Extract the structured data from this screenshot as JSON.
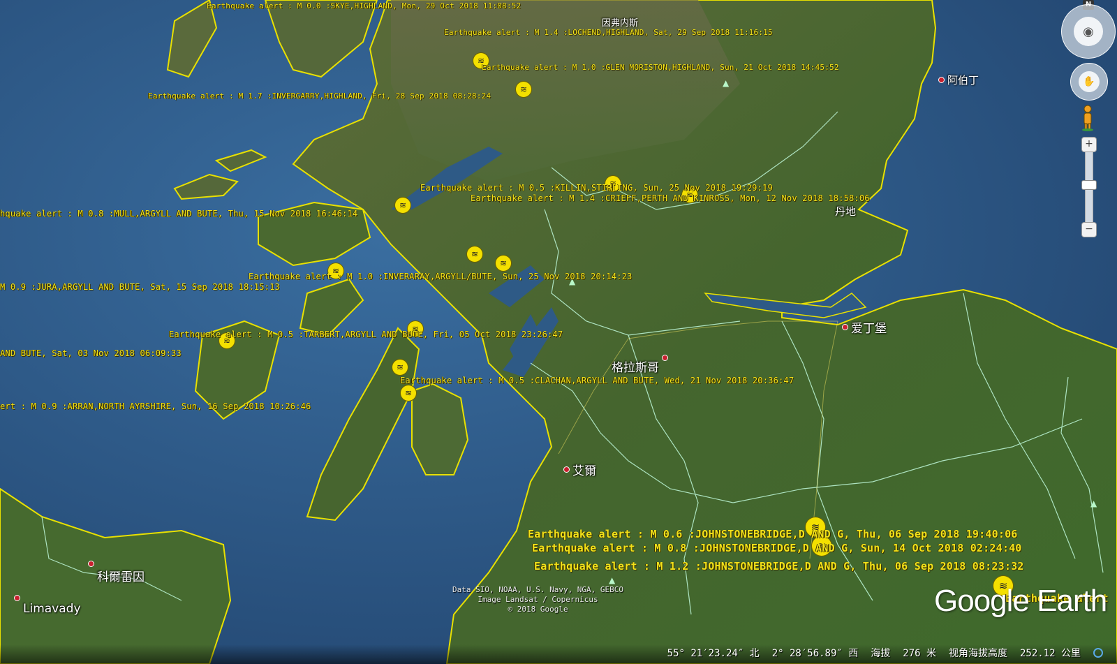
{
  "alerts": [
    {
      "id": "skye",
      "text": "Earthquake alert : M  0.0 :SKYE,HIGHLAND, Mon, 29 Oct 2018 11:08:52"
    },
    {
      "id": "lochend",
      "text": "Earthquake alert : M  1.4 :LOCHEND,HIGHLAND, Sat, 29 Sep 2018 11:16:15"
    },
    {
      "id": "glen-moriston",
      "text": "Earthquake alert : M  1.0 :GLEN MORISTON,HIGHLAND, Sun, 21 Oct 2018 14:45:52"
    },
    {
      "id": "invergarry",
      "text": "Earthquake alert : M  1.7 :INVERGARRY,HIGHLAND, Fri, 28 Sep 2018 08:28:24"
    },
    {
      "id": "killin",
      "text": "Earthquake alert : M  0.5 :KILLIN,STIRLING, Sun, 25 Nov 2018 19:29:19"
    },
    {
      "id": "crieff",
      "text": "Earthquake alert : M  1.4 :CRIEFF,PERTH AND KINROSS, Mon, 12 Nov 2018 18:58:06"
    },
    {
      "id": "mull",
      "text": "hquake alert : M  0.8 :MULL,ARGYLL AND BUTE, Thu, 15 Nov 2018 16:46:14"
    },
    {
      "id": "inveraray",
      "text": "Earthquake alert : M  1.0 :INVERARAY,ARGYLL/BUTE, Sun, 25 Nov 2018 20:14:23"
    },
    {
      "id": "jura",
      "text": "M  0.9 :JURA,ARGYLL AND BUTE, Sat, 15 Sep 2018 18:15:13"
    },
    {
      "id": "tarbert",
      "text": "Earthquake alert : M  0.5 :TARBERT,ARGYLL AND BUTE, Fri, 05 Oct 2018 23:26:47"
    },
    {
      "id": "islay",
      "text": "AND BUTE, Sat, 03 Nov 2018 06:09:33"
    },
    {
      "id": "clachan",
      "text": "Earthquake alert : M  0.5 :CLACHAN,ARGYLL AND BUTE, Wed, 21 Nov 2018 20:36:47"
    },
    {
      "id": "arran",
      "text": "ert : M  0.9 :ARRAN,NORTH AYRSHIRE, Sun, 16 Sep 2018 10:26:46"
    },
    {
      "id": "johnstonebridge-1",
      "text": "Earthquake alert : M  0.6 :JOHNSTONEBRIDGE,D AND G, Thu, 06 Sep 2018 19:40:06"
    },
    {
      "id": "johnstonebridge-2",
      "text": "Earthquake alert : M  0.8 :JOHNSTONEBRIDGE,D AND G, Sun, 14 Oct 2018 02:24:40"
    },
    {
      "id": "johnstonebridge-3",
      "text": "Earthquake alert : M  1.2 :JOHNSTONEBRIDGE,D AND G, Thu, 06 Sep 2018 08:23:32"
    },
    {
      "id": "edge-se",
      "text": "Earthquake alert"
    }
  ],
  "cities": {
    "inverness": "因弗内斯",
    "aberdeen": "阿伯丁",
    "dundee": "丹地",
    "edinburgh": "爱丁堡",
    "glasgow": "格拉斯哥",
    "ayr": "艾爾",
    "coleraine": "科爾雷因",
    "limavady": "Limavady"
  },
  "attribution": {
    "line1": "Data SIO, NOAA, U.S. Navy, NGA, GEBCO",
    "line2": "Image Landsat / Copernicus",
    "line3": "© 2018 Google"
  },
  "logo": "Google Earth",
  "status": {
    "lat": "55° 21′23.24″ 北",
    "lon": "2° 28′56.89″ 西",
    "elev_label": "海拔",
    "elev_value": "276 米",
    "eye_label": "视角海拔高度",
    "eye_value": "252.12 公里"
  },
  "nav": {
    "north": "N",
    "zoom_in": "+",
    "zoom_out": "−"
  },
  "icons": {
    "earthquake": "earthquake-marker-icon",
    "city": "city-dot-icon",
    "mountain": "mountain-peak-icon",
    "look": "look-joystick-icon",
    "move": "move-joystick-icon",
    "pegman": "street-view-pegman-icon"
  },
  "colors": {
    "sea": "#2a4f7a",
    "land": "#4a6a32",
    "coast": "#e8e000",
    "border": "#b8f0d0",
    "alert_text": "#f2e21a"
  }
}
